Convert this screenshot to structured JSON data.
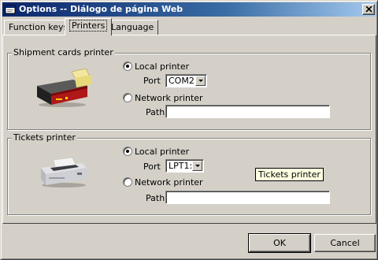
{
  "window": {
    "title": "Options -- Diálogo de página Web"
  },
  "tabs": [
    {
      "label": "Function keys",
      "active": false
    },
    {
      "label": "Printers",
      "active": true
    },
    {
      "label": "Language",
      "active": false
    }
  ],
  "shipment": {
    "legend": "Shipment cards printer",
    "local_label": "Local printer",
    "port_label": "Port",
    "port_value": "COM2:",
    "network_label": "Network printer",
    "path_label": "Path",
    "path_value": "",
    "selected": "local"
  },
  "tickets": {
    "legend": "Tickets printer",
    "local_label": "Local printer",
    "port_label": "Port",
    "port_value": "LPT1:",
    "network_label": "Network printer",
    "path_label": "Path",
    "path_value": "",
    "selected": "local"
  },
  "tooltip": "Tickets printer",
  "buttons": {
    "ok": "OK",
    "cancel": "Cancel"
  },
  "colors": {
    "title_start": "#0a246a",
    "title_end": "#a6caf0",
    "face": "#d4d0c8",
    "tooltip_bg": "#ffffe1"
  },
  "icons": {
    "title": "options-window-icon",
    "close": "close-icon",
    "shipment_printer": "card-printer-image",
    "tickets_printer": "dot-matrix-printer-image"
  }
}
